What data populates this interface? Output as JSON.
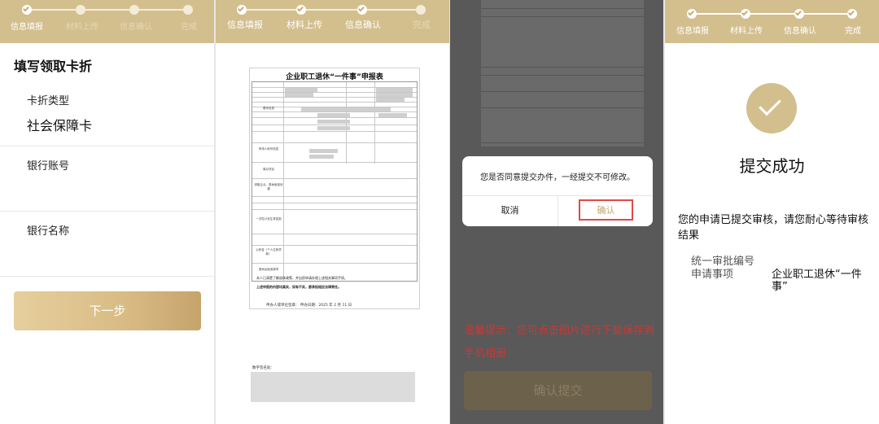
{
  "steps": [
    "信息填报",
    "材料上传",
    "信息确认",
    "完成"
  ],
  "form": {
    "title": "填写领取卡折",
    "card_type_label": "卡折类型",
    "card_type_value": "社会保障卡",
    "bank_account_label": "银行账号",
    "bank_name_label": "银行名称",
    "next_button": "下一步"
  },
  "document": {
    "title": "企业职工退休“一件事”申报表",
    "sections": [
      "基本信息",
      "申领人帐号信息",
      "事办项目",
      "领取企业、退休医保待遇",
      "一次性计划生育奖励",
      "公积金（个人住房贷款）",
      "退休后医保事项"
    ],
    "note_1": "本人已清楚了解退休政策，并自愿申请办理上述相关事项手续。",
    "note_2": "上述申报的内容均真实，如有不实，愿承担相应法律责任。",
    "sign_line": "申办人或单位签章：                    申办日期：2025 年 2 月 11 日",
    "signature_label": "数字签名处："
  },
  "confirm": {
    "tip": "温馨提示：您可点击图片进行下载保存到手机相册",
    "submit_button": "确认提交",
    "dialog_message": "您是否同意提交办件，一经提交不可修改。",
    "dialog_cancel": "取消",
    "dialog_ok": "确认"
  },
  "result": {
    "title": "提交成功",
    "description": "您的申请已提交审核，请您耐心等待审核结果",
    "approval_no_label": "统一审批编号",
    "matter_label": "申请事项",
    "matter_value": "企业职工退休“一件事”"
  },
  "colors": {
    "gold": "#d3bf8e",
    "tip_red": "#c63a3a",
    "confirm_border": "#e24848"
  }
}
